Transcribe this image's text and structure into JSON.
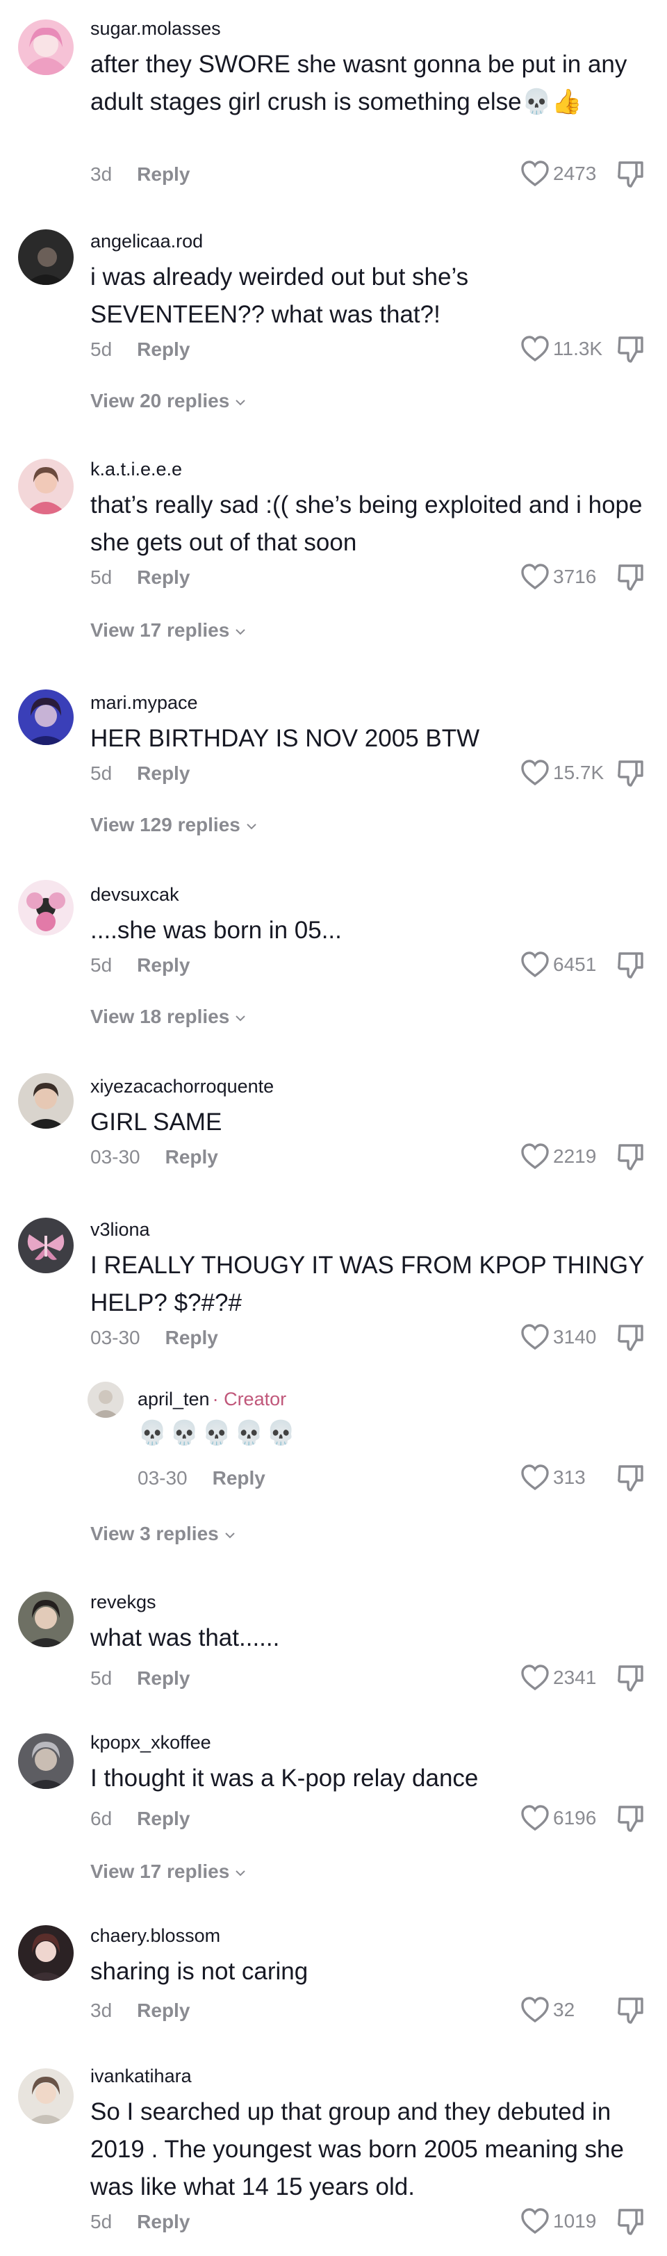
{
  "comments": [
    {
      "username": "sugar.molasses",
      "text": "after they SWORE she wasnt gonna be put in any adult stages girl crush is something else💀👍",
      "time": "3d",
      "reply_label": "Reply",
      "likes": "2473",
      "view_replies": ""
    },
    {
      "username": "angelicaa.rod",
      "text": "i was already weirded out but she’s SEVENTEEN?? what was that?!",
      "time": "5d",
      "reply_label": "Reply",
      "likes": "11.3K",
      "view_replies": "View 20 replies"
    },
    {
      "username": "k.a.t.i.e.e.e",
      "text": "that’s really sad :(( she’s being exploited and i hope she gets out of that soon",
      "time": "5d",
      "reply_label": "Reply",
      "likes": "3716",
      "view_replies": "View 17 replies"
    },
    {
      "username": "mari.mypace",
      "text": "HER BIRTHDAY IS NOV 2005 BTW",
      "time": "5d",
      "reply_label": "Reply",
      "likes": "15.7K",
      "view_replies": "View 129 replies"
    },
    {
      "username": "devsuxcak",
      "text": "....she was born in 05...",
      "time": "5d",
      "reply_label": "Reply",
      "likes": "6451",
      "view_replies": "View 18 replies"
    },
    {
      "username": "xiyezacachorroquente",
      "text": "GIRL SAME",
      "time": "03-30",
      "reply_label": "Reply",
      "likes": "2219",
      "view_replies": ""
    },
    {
      "username": "v3liona",
      "text": "I REALLY THOUGY IT WAS FROM KPOP THINGY HELP? $?#?#",
      "time": "03-30",
      "reply_label": "Reply",
      "likes": "3140",
      "view_replies": "View 3 replies",
      "reply": {
        "username": "april_ten",
        "creator_tag": "· Creator",
        "text": "💀💀💀💀💀",
        "time": "03-30",
        "reply_label": "Reply",
        "likes": "313"
      }
    },
    {
      "username": "revekgs",
      "text": "what was that......",
      "time": "5d",
      "reply_label": "Reply",
      "likes": "2341",
      "view_replies": ""
    },
    {
      "username": "kpopx_xkoffee",
      "text": "I thought it was a K-pop relay dance",
      "time": "6d",
      "reply_label": "Reply",
      "likes": "6196",
      "view_replies": "View 17 replies"
    },
    {
      "username": "chaery.blossom",
      "text": "sharing is not caring",
      "time": "3d",
      "reply_label": "Reply",
      "likes": "32",
      "view_replies": ""
    },
    {
      "username": "ivankatihara",
      "text": "So I searched up that group and they debuted in 2019 . The youngest was born 2005 meaning she was like what 14 15 years old.",
      "time": "5d",
      "reply_label": "Reply",
      "likes": "1019",
      "view_replies": ""
    }
  ],
  "icons": {
    "like": "heart-outline-icon",
    "dislike": "thumbs-down-outline-icon",
    "chevron": "chevron-down-icon"
  },
  "colors": {
    "text": "#161823",
    "muted": "#8a8b91",
    "creator": "#c0577a"
  }
}
